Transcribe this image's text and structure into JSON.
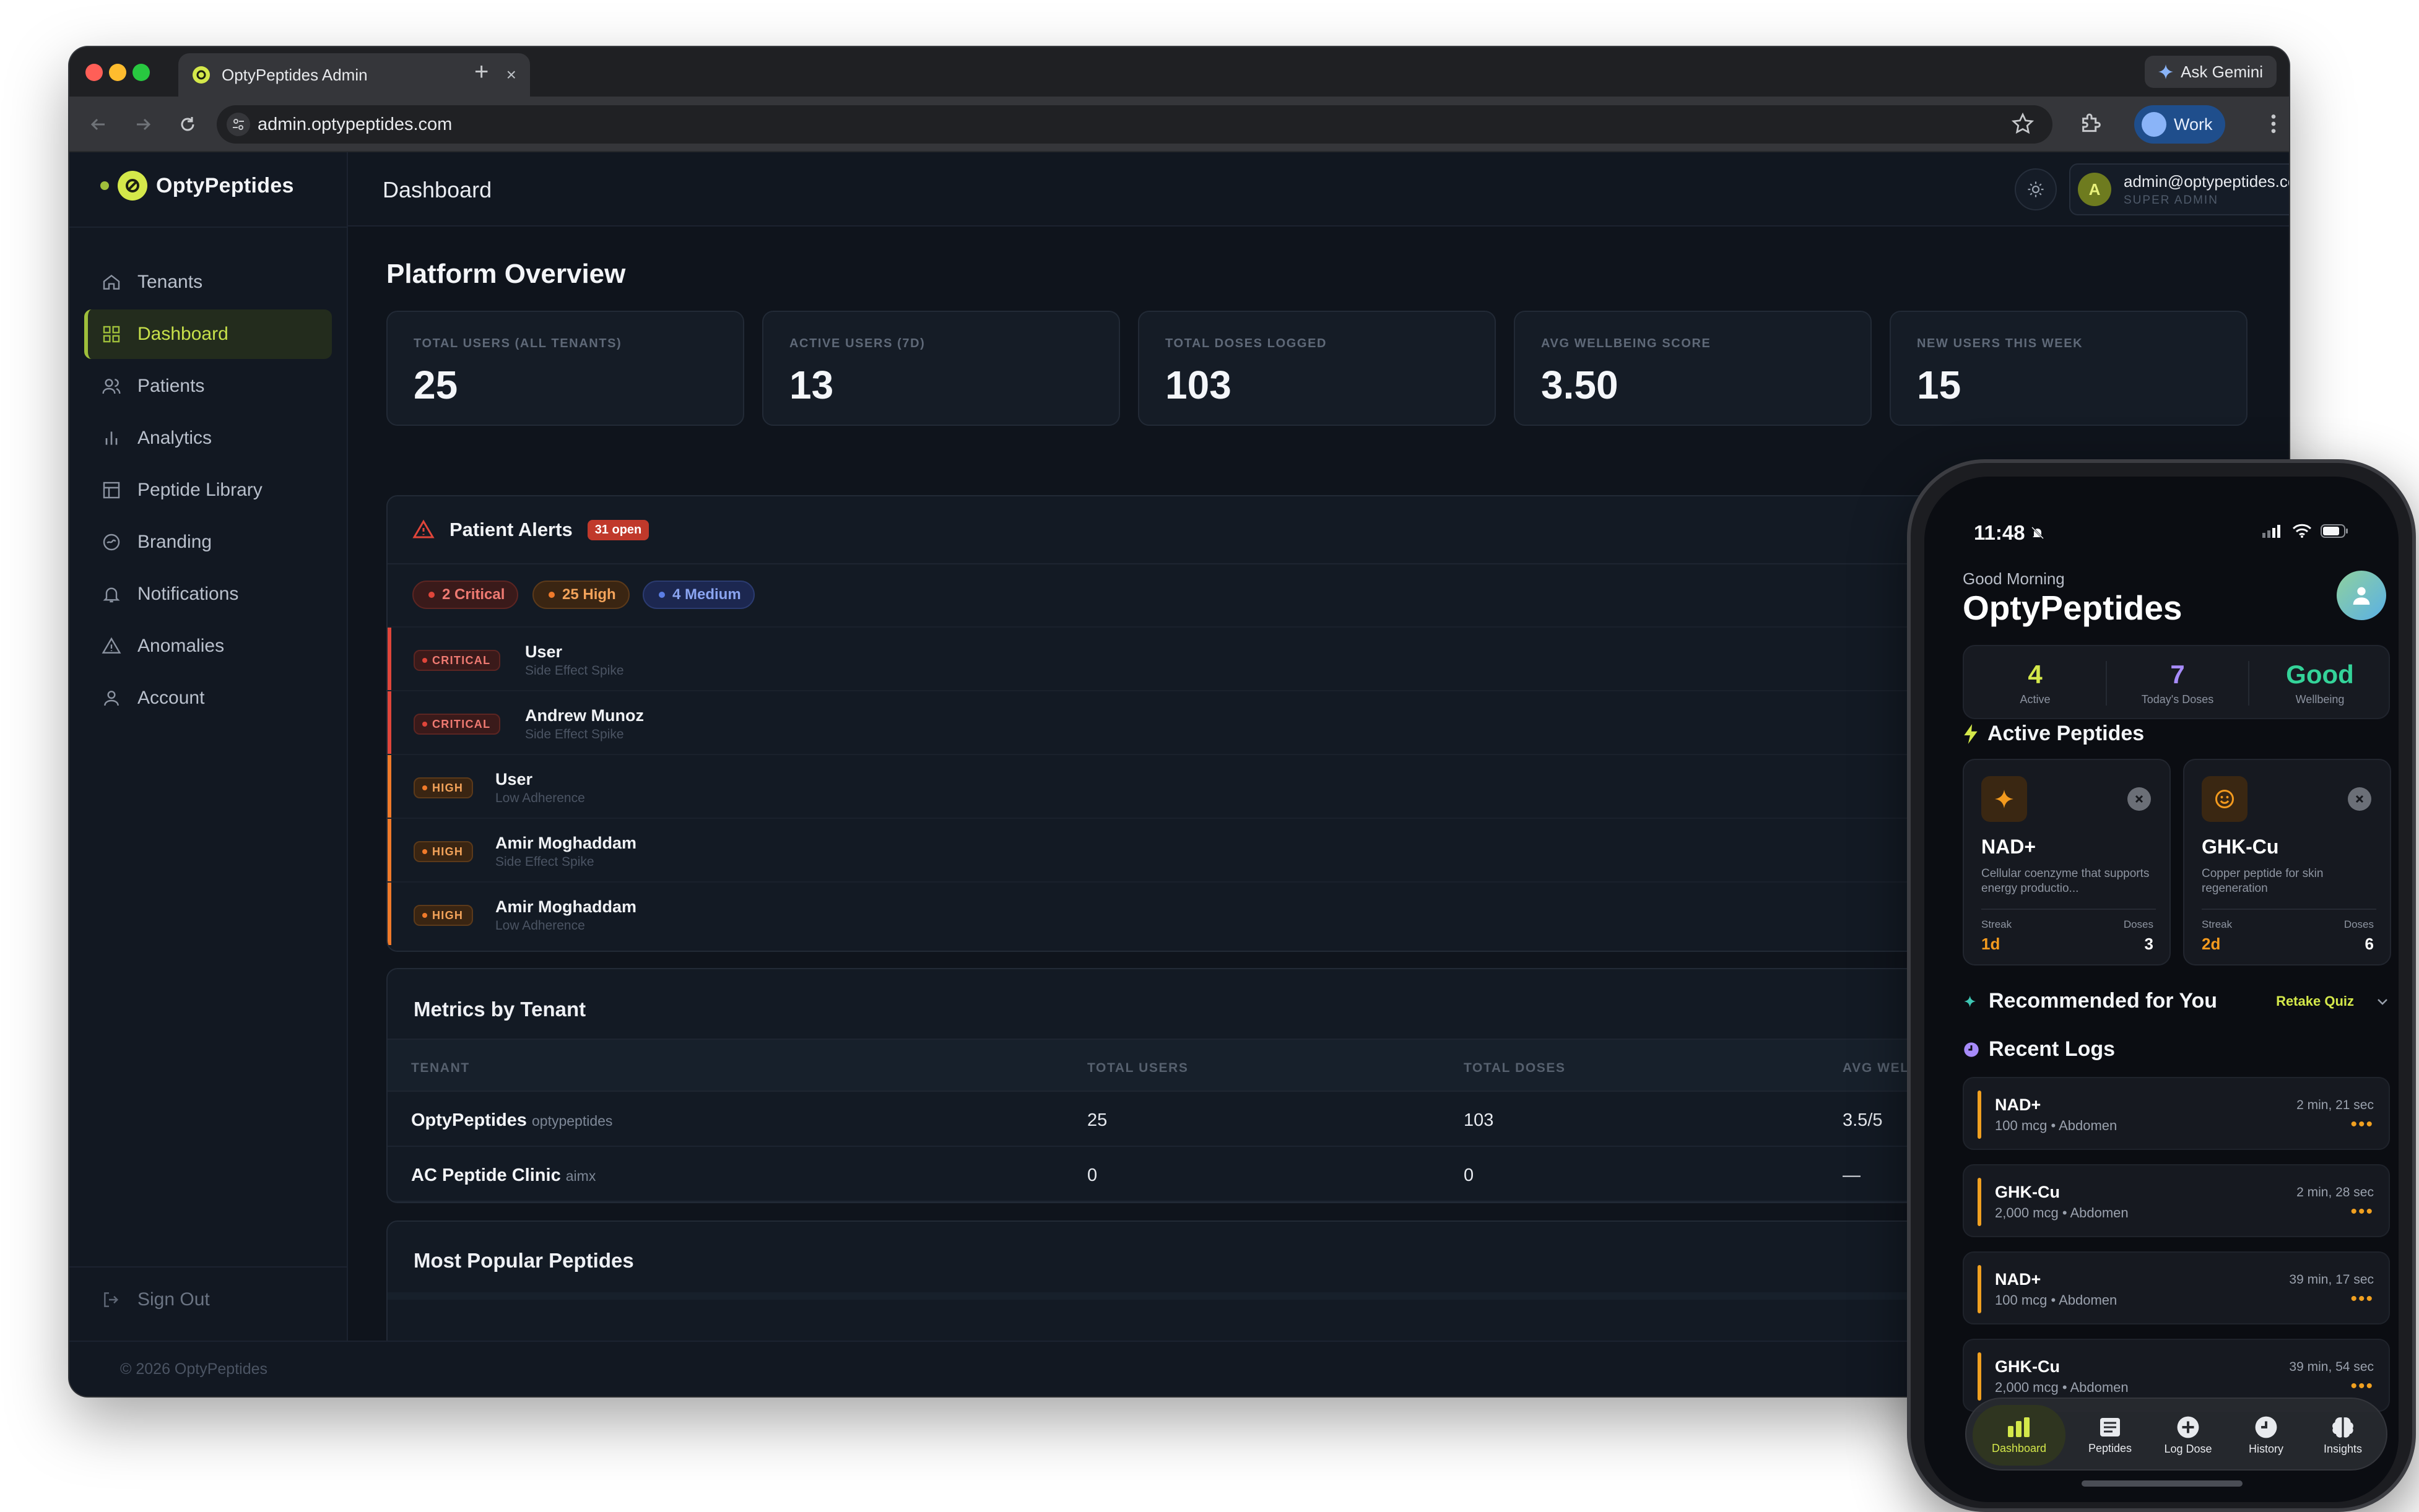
{
  "browser": {
    "tab_title": "OptyPeptides Admin",
    "new_tab_symbol": "+",
    "close_symbol": "×",
    "gemini_label": "Ask Gemini",
    "url": "admin.optypeptides.com",
    "profile_label": "Work"
  },
  "sidebar": {
    "brand": "OptyPeptides",
    "items": [
      {
        "label": "Tenants",
        "icon": "home-icon"
      },
      {
        "label": "Dashboard",
        "icon": "grid-icon",
        "active": true
      },
      {
        "label": "Patients",
        "icon": "users-icon"
      },
      {
        "label": "Analytics",
        "icon": "bar-chart-icon"
      },
      {
        "label": "Peptide Library",
        "icon": "library-icon"
      },
      {
        "label": "Branding",
        "icon": "palette-icon"
      },
      {
        "label": "Notifications",
        "icon": "bell-icon"
      },
      {
        "label": "Anomalies",
        "icon": "warning-icon"
      },
      {
        "label": "Account",
        "icon": "user-icon"
      }
    ],
    "sign_out": "Sign Out",
    "footer": "© 2026 OptyPeptides"
  },
  "header": {
    "title": "Dashboard",
    "user_avatar": "A",
    "user_email": "admin@optypeptides.com",
    "user_role": "SUPER ADMIN"
  },
  "overview": {
    "title": "Platform Overview",
    "stats": [
      {
        "label": "TOTAL USERS (ALL TENANTS)",
        "value": "25"
      },
      {
        "label": "ACTIVE USERS (7D)",
        "value": "13"
      },
      {
        "label": "TOTAL DOSES LOGGED",
        "value": "103"
      },
      {
        "label": "AVG WELLBEING SCORE",
        "value": "3.50"
      },
      {
        "label": "NEW USERS THIS WEEK",
        "value": "15"
      }
    ]
  },
  "alerts": {
    "title": "Patient Alerts",
    "open_badge": "31 open",
    "filters": [
      {
        "label": "2 Critical",
        "level": "critical"
      },
      {
        "label": "25 High",
        "level": "high"
      },
      {
        "label": "4 Medium",
        "level": "medium"
      }
    ],
    "rows": [
      {
        "severity": "CRITICAL",
        "name": "User",
        "reason": "Side Effect Spike"
      },
      {
        "severity": "CRITICAL",
        "name": "Andrew Munoz",
        "reason": "Side Effect Spike"
      },
      {
        "severity": "HIGH",
        "name": "User",
        "reason": "Low Adherence"
      },
      {
        "severity": "HIGH",
        "name": "Amir Moghaddam",
        "reason": "Side Effect Spike"
      },
      {
        "severity": "HIGH",
        "name": "Amir Moghaddam",
        "reason": "Low Adherence"
      }
    ]
  },
  "metrics": {
    "title": "Metrics by Tenant",
    "columns": [
      "TENANT",
      "TOTAL USERS",
      "TOTAL DOSES",
      "AVG WEL"
    ],
    "rows": [
      {
        "tenant": "OptyPeptides",
        "slug": "optypeptides",
        "users": "25",
        "doses": "103",
        "avg": "3.5/5"
      },
      {
        "tenant": "AC Peptide Clinic",
        "slug": "aimx",
        "users": "0",
        "doses": "0",
        "avg": "—"
      }
    ]
  },
  "popular": {
    "title": "Most Popular Peptides"
  },
  "colors": {
    "accent": "#d4e84a",
    "critical": "#e0453a",
    "high": "#f07a2a",
    "medium": "#5b7ee5",
    "background": "#0f141c"
  },
  "phone": {
    "time": "11:48",
    "greeting": "Good Morning",
    "app_title": "OptyPeptides",
    "summary": [
      {
        "value": "4",
        "label": "Active",
        "color": "#d4e84a"
      },
      {
        "value": "7",
        "label": "Today's Doses",
        "color": "#a78bfa"
      },
      {
        "value": "Good",
        "label": "Wellbeing",
        "color": "#34d399"
      }
    ],
    "active_title": "Active Peptides",
    "cards": [
      {
        "name": "NAD+",
        "desc": "Cellular coenzyme that supports energy productio...",
        "streak_label": "Streak",
        "streak": "1d",
        "doses_label": "Doses",
        "doses": "3",
        "icon": "sparkle-icon"
      },
      {
        "name": "GHK-Cu",
        "desc": "Copper peptide for skin regeneration",
        "streak_label": "Streak",
        "streak": "2d",
        "doses_label": "Doses",
        "doses": "6",
        "icon": "smile-icon"
      }
    ],
    "recommended_title": "Recommended for You",
    "retake_quiz": "Retake Quiz",
    "recent_title": "Recent Logs",
    "logs": [
      {
        "name": "NAD+",
        "detail": "100 mcg • Abdomen",
        "time": "2 min, 21 sec"
      },
      {
        "name": "GHK-Cu",
        "detail": "2,000 mcg • Abdomen",
        "time": "2 min, 28 sec"
      },
      {
        "name": "NAD+",
        "detail": "100 mcg • Abdomen",
        "time": "39 min, 17 sec"
      },
      {
        "name": "GHK-Cu",
        "detail": "2,000 mcg • Abdomen",
        "time": "39 min, 54 sec"
      }
    ],
    "tabs": [
      {
        "label": "Dashboard",
        "active": true
      },
      {
        "label": "Peptides"
      },
      {
        "label": "Log Dose"
      },
      {
        "label": "History"
      },
      {
        "label": "Insights"
      }
    ]
  }
}
